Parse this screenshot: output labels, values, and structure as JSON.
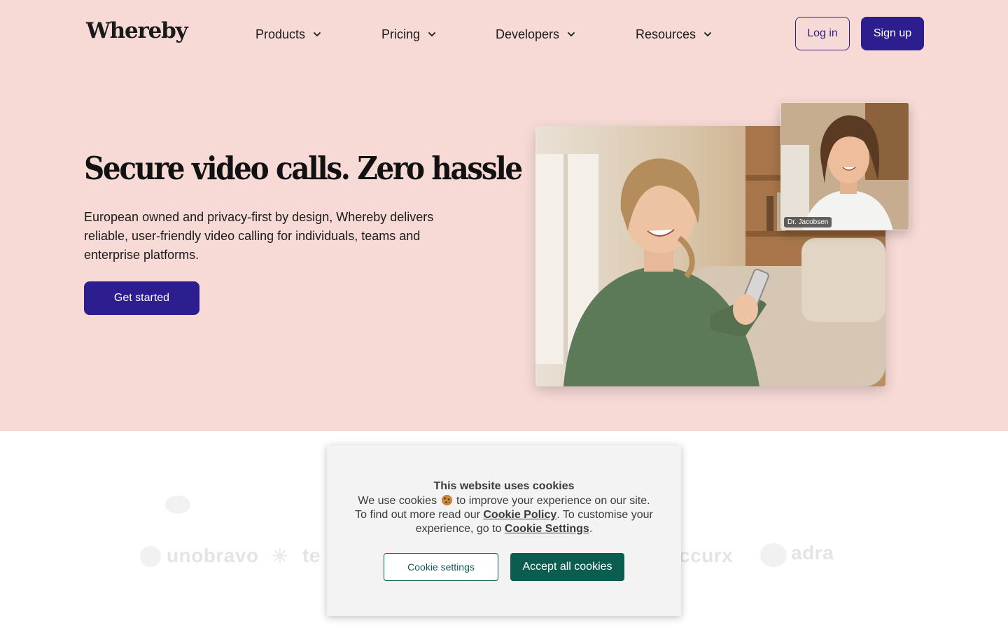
{
  "brand": {
    "logo_text": "Whereby"
  },
  "nav": {
    "items": [
      {
        "label": "Products",
        "icon": "chevron-down-icon"
      },
      {
        "label": "Pricing",
        "icon": "chevron-down-icon"
      },
      {
        "label": "Developers",
        "icon": "chevron-down-icon"
      },
      {
        "label": "Resources",
        "icon": "chevron-down-icon"
      }
    ],
    "login_label": "Log in",
    "signup_label": "Sign up"
  },
  "hero": {
    "headline": "Secure video calls. Zero hassle",
    "subtext": "European owned and privacy-first by design, Whereby delivers reliable, user-friendly video calling for individuals, teams and enterprise platforms.",
    "cta_label": "Get started",
    "pip_participant": "Dr. Jacobsen"
  },
  "logos": [
    "unobravo",
    "te",
    "ccurx",
    "adra"
  ],
  "cookie_banner": {
    "title": "This website uses cookies",
    "line1_before": "We use cookies",
    "emoji": "cookie-icon",
    "line1_after": "to improve your experience on our site.",
    "line2_before": "To find out more read our",
    "policy_link": "Cookie Policy",
    "line2_after": ". To customise your experience, go to",
    "settings_link": "Cookie Settings",
    "line2_end": ".",
    "settings_button": "Cookie settings",
    "accept_button": "Accept all cookies"
  },
  "colors": {
    "hero_bg": "#f7dad6",
    "primary": "#2d1e8f",
    "cookie_accent": "#0b5e4f"
  }
}
